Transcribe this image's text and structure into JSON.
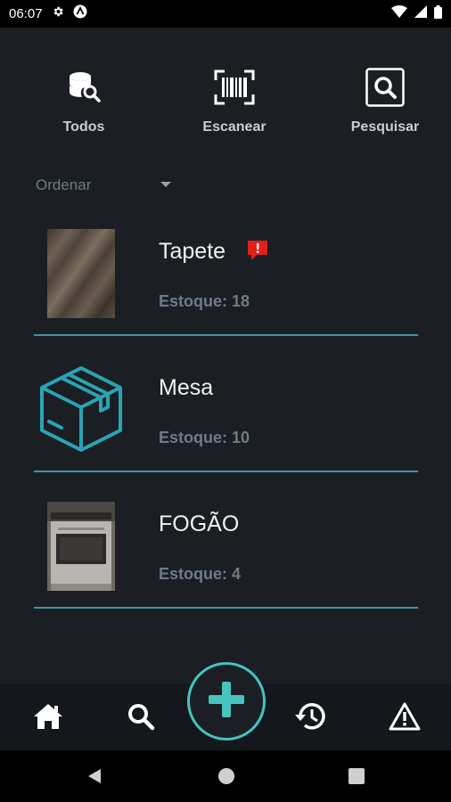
{
  "status_bar": {
    "time": "06:07",
    "icons": [
      "settings-icon",
      "app-notification-icon",
      "wifi-icon",
      "signal-icon",
      "battery-icon"
    ]
  },
  "top_actions": [
    {
      "label": "Todos",
      "icon": "database-search-icon"
    },
    {
      "label": "Escanear",
      "icon": "barcode-scan-icon"
    },
    {
      "label": "Pesquisar",
      "icon": "search-box-icon"
    }
  ],
  "sort": {
    "label": "Ordenar",
    "icon": "caret-down-icon"
  },
  "items": [
    {
      "name": "Tapete",
      "stock": "Estoque: 18",
      "image": "rug-photo",
      "alert": true
    },
    {
      "name": "Mesa",
      "stock": "Estoque: 10",
      "image": "box-icon",
      "alert": false
    },
    {
      "name": "FOGÃO",
      "stock": "Estoque: 4",
      "image": "stove-photo",
      "alert": false
    }
  ],
  "bottom_nav": {
    "items": [
      "home-icon",
      "search-icon",
      "add-icon",
      "history-icon",
      "warning-icon"
    ]
  },
  "colors": {
    "background": "#1b1f24",
    "accent": "#45c4c0",
    "divider": "#3b9a9c",
    "muted_text": "#6f7a8a",
    "alert": "#e0201c"
  }
}
